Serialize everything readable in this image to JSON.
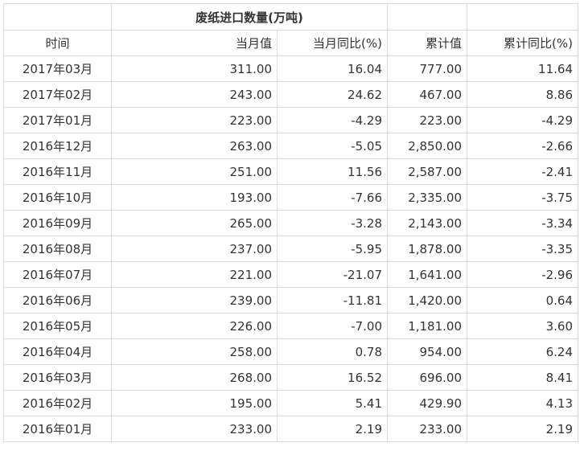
{
  "table": {
    "title": "废纸进口数量(万吨)",
    "headers": [
      "时间",
      "当月值",
      "当月同比(%)",
      "累计值",
      "累计同比(%)"
    ],
    "rows": [
      [
        "2017年03月",
        "311.00",
        "16.04",
        "777.00",
        "11.64"
      ],
      [
        "2017年02月",
        "243.00",
        "24.62",
        "467.00",
        "8.86"
      ],
      [
        "2017年01月",
        "223.00",
        "-4.29",
        "223.00",
        "-4.29"
      ],
      [
        "2016年12月",
        "263.00",
        "-5.05",
        "2,850.00",
        "-2.66"
      ],
      [
        "2016年11月",
        "251.00",
        "11.56",
        "2,587.00",
        "-2.41"
      ],
      [
        "2016年10月",
        "193.00",
        "-7.66",
        "2,335.00",
        "-3.75"
      ],
      [
        "2016年09月",
        "265.00",
        "-3.28",
        "2,143.00",
        "-3.34"
      ],
      [
        "2016年08月",
        "237.00",
        "-5.95",
        "1,878.00",
        "-3.35"
      ],
      [
        "2016年07月",
        "221.00",
        "-21.07",
        "1,641.00",
        "-2.96"
      ],
      [
        "2016年06月",
        "239.00",
        "-11.81",
        "1,420.00",
        "0.64"
      ],
      [
        "2016年05月",
        "226.00",
        "-7.00",
        "1,181.00",
        "3.60"
      ],
      [
        "2016年04月",
        "258.00",
        "0.78",
        "954.00",
        "6.24"
      ],
      [
        "2016年03月",
        "268.00",
        "16.52",
        "696.00",
        "8.41"
      ],
      [
        "2016年02月",
        "195.00",
        "5.41",
        "429.90",
        "4.13"
      ],
      [
        "2016年01月",
        "233.00",
        "2.19",
        "233.00",
        "2.19"
      ]
    ]
  }
}
